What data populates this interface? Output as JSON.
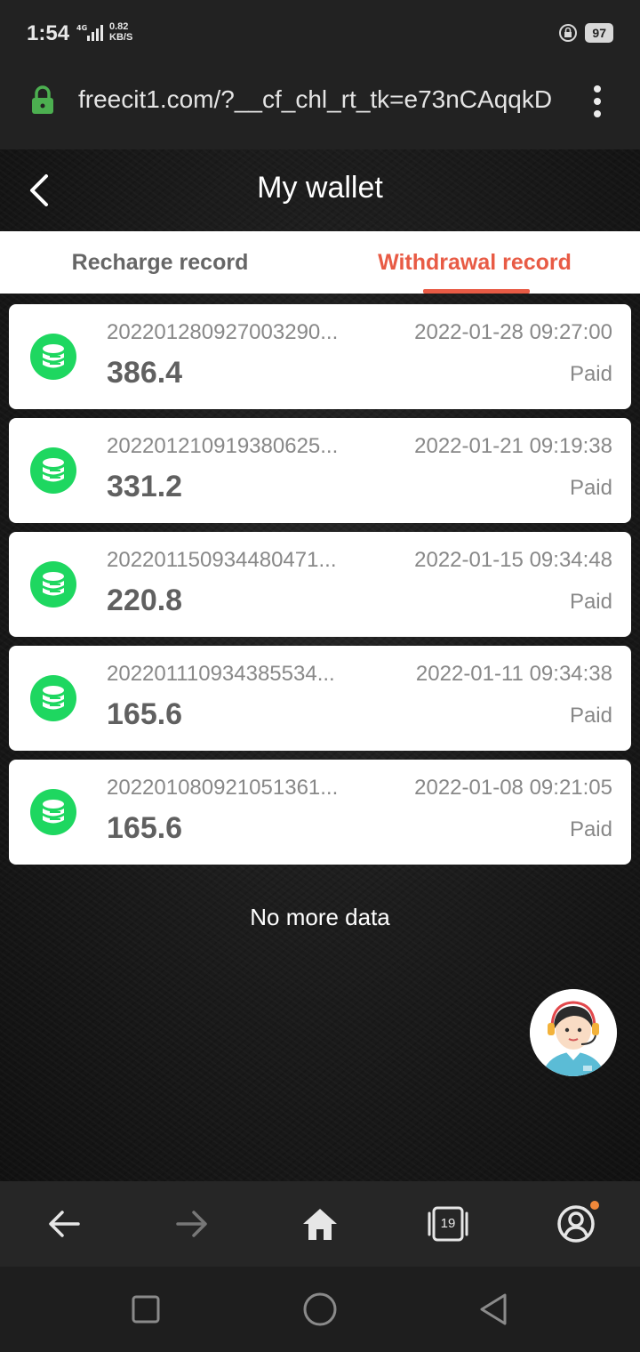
{
  "status_bar": {
    "time": "1:54",
    "network": "4G",
    "speed_value": "0.82",
    "speed_unit": "KB/S",
    "battery": "97"
  },
  "browser": {
    "url": "freecit1.com/?__cf_chl_rt_tk=e73nCAqqkD",
    "tabs_count": "19",
    "lock_color": "#4caf50"
  },
  "header": {
    "title": "My wallet"
  },
  "tabs": [
    {
      "label": "Recharge record",
      "active": false
    },
    {
      "label": "Withdrawal record",
      "active": true
    }
  ],
  "accent_color": "#e85b45",
  "records": [
    {
      "id": "202201280927003290...",
      "time": "2022-01-28 09:27:00",
      "amount": "386.4",
      "status": "Paid"
    },
    {
      "id": "202201210919380625...",
      "time": "2022-01-21 09:19:38",
      "amount": "331.2",
      "status": "Paid"
    },
    {
      "id": "202201150934480471...",
      "time": "2022-01-15 09:34:48",
      "amount": "220.8",
      "status": "Paid"
    },
    {
      "id": "202201110934385534...",
      "time": "2022-01-11 09:34:38",
      "amount": "165.6",
      "status": "Paid"
    },
    {
      "id": "202201080921051361...",
      "time": "2022-01-08 09:21:05",
      "amount": "165.6",
      "status": "Paid"
    }
  ],
  "no_more_text": "No more data",
  "icons": {
    "record": "coin-stack-icon",
    "support": "customer-service-avatar"
  }
}
